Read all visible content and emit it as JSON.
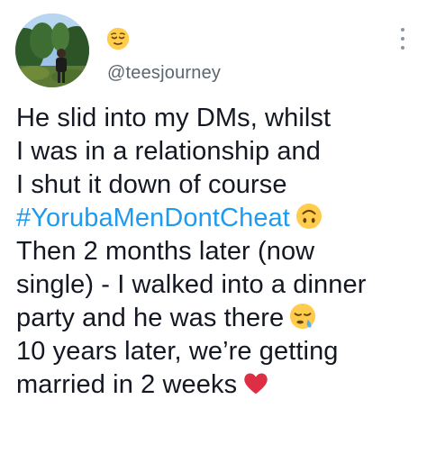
{
  "tweet": {
    "display_name_emoji": "relieved-face-emoji",
    "handle": "@teesjourney",
    "lines": {
      "l1": "He slid into my DMs, whilst",
      "l2": "I was in a relationship and",
      "l3": "I shut it down of course",
      "hashtag": "#YorubaMenDontCheat",
      "l5": "Then 2 months later (now",
      "l6": "single) - I walked into a dinner",
      "l7": "party and he was there",
      "l8": "10 years later, we’re getting",
      "l9": "married in 2 weeks"
    },
    "emojis": {
      "after_hashtag": "upside-down-face-emoji",
      "after_party": "sleepy-face-emoji",
      "after_weeks": "red-heart-emoji"
    }
  },
  "colors": {
    "text": "#141823",
    "handle": "#5b6670",
    "hashtag": "#1d9bf0",
    "menu_dots": "#8a96a3",
    "background": "#ffffff"
  }
}
